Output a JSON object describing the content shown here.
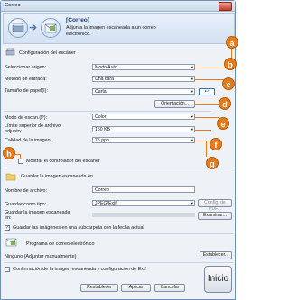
{
  "window": {
    "title": "Correo",
    "close_glyph": "✕"
  },
  "header": {
    "title": "[Correo]",
    "description_line1": "Adjunta la imagen escaneada a un correo",
    "description_line2": "electrónico.",
    "arrow": "➜"
  },
  "scanner_section": {
    "title": "Configuración del escáner",
    "fields": [
      {
        "label": "Seleccionar origen:",
        "value": "Modo Auto"
      },
      {
        "label": "Método de entrada:",
        "value": "Una cara"
      },
      {
        "label": "Tamaño de papel(I):",
        "value": "Carta"
      },
      {
        "label": "Modo de escan.(P):",
        "value": "Color"
      },
      {
        "label_line1": "Límite superior de archivo",
        "label_line2": "adjunto:",
        "value": "150 KB"
      },
      {
        "label": "Calidad de la imagen:",
        "value": "75 ppp"
      }
    ],
    "orientation_button": "Orientación...",
    "show_driver_checkbox": "Mostrar el controlador del escáner"
  },
  "save_section": {
    "title": "Guardar la imagen escaneada en",
    "filename_label": "Nombre de archivo:",
    "filename_value": "Correo",
    "savetype_label": "Guardar como tipo:",
    "savetype_value": "JPEG/Exif",
    "config_pdf_button": "Config. de PDF...",
    "savepath_label_line1": "Guardar la imagen escaneada",
    "savepath_label_line2": "en:",
    "browse_button": "Examinar...",
    "subfolder_checkbox": "Guardar las imágenes en una subcarpeta con la fecha actual",
    "subfolder_checked": true
  },
  "mail_section": {
    "title": "Programa de correo electrónico",
    "mail_value": "Ninguno (Adjuntar manualmente)",
    "settings_button": "Establecer..."
  },
  "confirm_checkbox": "Confirmación de la imagen escaneada y configuración de Exif",
  "buttons": {
    "reset": "Restablecer",
    "apply": "Aplicar",
    "cancel": "Cancelar",
    "start": "Inicio"
  },
  "badges": [
    "a",
    "b",
    "c",
    "d",
    "e",
    "f",
    "g",
    "h"
  ],
  "icons": {
    "dropdown_arrow": "▾",
    "check": "✓",
    "badge_c_arrow": "↩"
  },
  "colors": {
    "badge_orange": "#e47c1e",
    "window_border": "#6f8fb3",
    "header_bg": "#dce8f6"
  }
}
